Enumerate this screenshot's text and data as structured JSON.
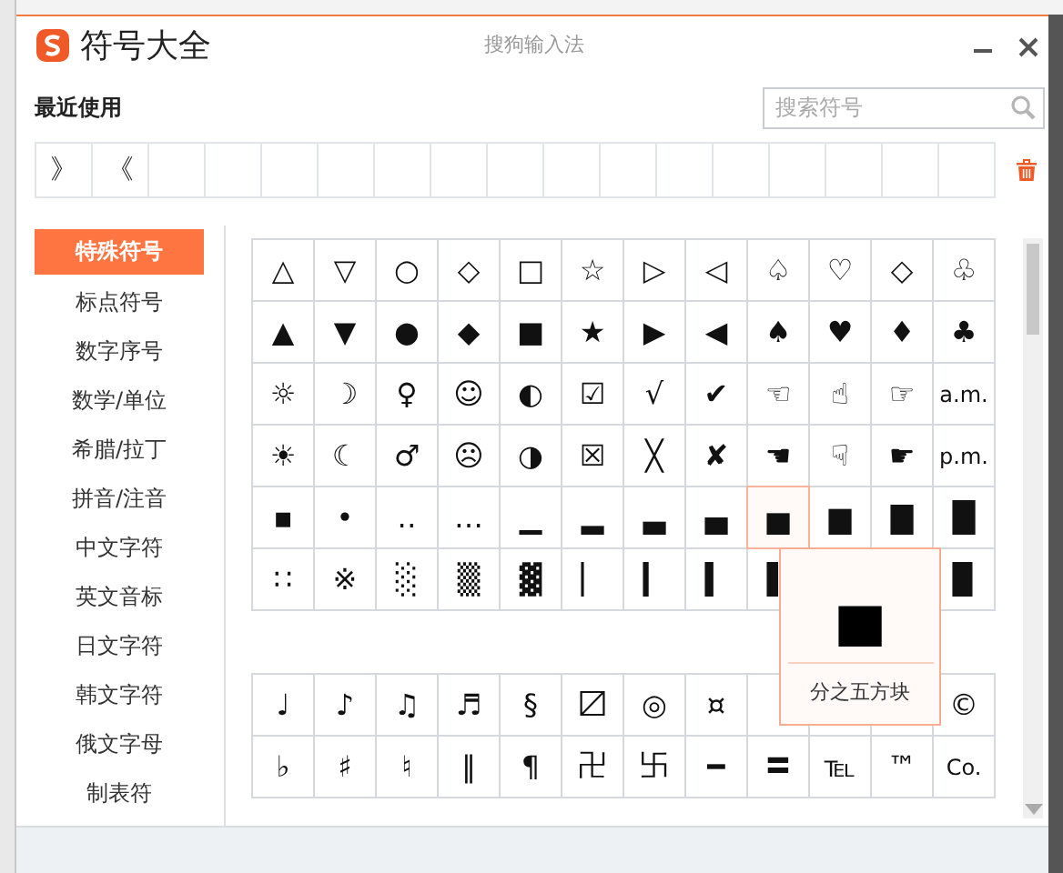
{
  "window": {
    "title": "符号大全",
    "app_name": "搜狗输入法"
  },
  "recent": {
    "label": "最近使用",
    "symbols": [
      "》",
      "《"
    ]
  },
  "search": {
    "placeholder": "搜索符号"
  },
  "categories": [
    {
      "label": "特殊符号",
      "selected": true
    },
    {
      "label": "标点符号",
      "selected": false
    },
    {
      "label": "数字序号",
      "selected": false
    },
    {
      "label": "数学/单位",
      "selected": false
    },
    {
      "label": "希腊/拉丁",
      "selected": false
    },
    {
      "label": "拼音/注音",
      "selected": false
    },
    {
      "label": "中文字符",
      "selected": false
    },
    {
      "label": "英文音标",
      "selected": false
    },
    {
      "label": "日文字符",
      "selected": false
    },
    {
      "label": "韩文字符",
      "selected": false
    },
    {
      "label": "俄文字母",
      "selected": false
    },
    {
      "label": "制表符",
      "selected": false
    }
  ],
  "symbol_blocks": [
    {
      "rows": [
        [
          "△",
          "▽",
          "○",
          "◇",
          "□",
          "☆",
          "▷",
          "◁",
          "♤",
          "♡",
          "◇",
          "♧"
        ],
        [
          "▲",
          "▼",
          "●",
          "◆",
          "■",
          "★",
          "▶",
          "◀",
          "♠",
          "♥",
          "♦",
          "♣"
        ],
        [
          "☼",
          "☽",
          "♀",
          "☺",
          "◐",
          "☑",
          "√",
          "✔",
          "☜",
          "☝",
          "☞",
          "a.m."
        ],
        [
          "☀",
          "☾",
          "♂",
          "☹",
          "◑",
          "☒",
          "╳",
          "✘",
          "☚",
          "☟",
          "☛",
          "p.m."
        ],
        [
          "▪",
          "•",
          "‥",
          "…",
          "▁",
          "▂",
          "▃",
          "▄",
          {
            "symbol": "▅",
            "hovered": true
          },
          "▆",
          "▇",
          "█"
        ],
        [
          "∷",
          "※",
          "░",
          "▒",
          "▓",
          "▏",
          "▎",
          "▍",
          "▌",
          null,
          null,
          "▉"
        ]
      ],
      "tooltip": {
        "symbol": "▅",
        "name": "分之五方块"
      }
    },
    {
      "rows": [
        [
          "♩",
          "♪",
          "♫",
          "♬",
          "§",
          "〼",
          "◎",
          "¤",
          null,
          null,
          null,
          "©"
        ],
        [
          "♭",
          "♯",
          "♮",
          "‖",
          "¶",
          "卍",
          "卐",
          "━",
          "〓",
          "℡",
          "™",
          "Co."
        ]
      ]
    }
  ]
}
